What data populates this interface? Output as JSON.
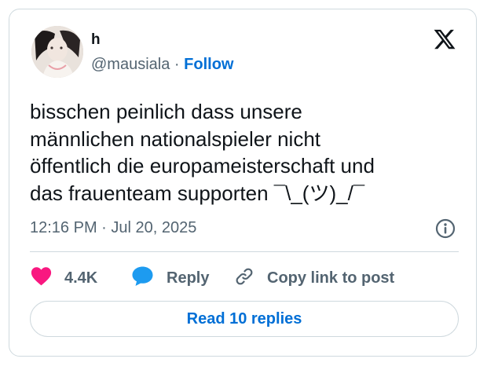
{
  "tweet": {
    "author_name": "h",
    "handle": "@mausiala",
    "separator": "·",
    "follow_label": "Follow",
    "text": "bisschen peinlich dass unsere\nmännlichen nationalspieler nicht\nöffentlich die europameisterschaft und\ndas frauenteam supporten ¯\\_(ツ)_/¯",
    "timestamp": "12:16 PM · Jul 20, 2025"
  },
  "actions": {
    "like_count": "4.4K",
    "reply_label": "Reply",
    "copy_label": "Copy link to post"
  },
  "read_replies_label": "Read 10 replies",
  "colors": {
    "accent": "#006fd6",
    "like": "#f91880",
    "reply_bubble": "#1d9bf0",
    "muted": "#536471",
    "border": "#cfd9de"
  },
  "icons": {
    "brand": "x-logo-icon",
    "info": "info-icon",
    "like": "heart-icon",
    "reply": "speech-bubble-icon",
    "copy": "link-icon"
  }
}
